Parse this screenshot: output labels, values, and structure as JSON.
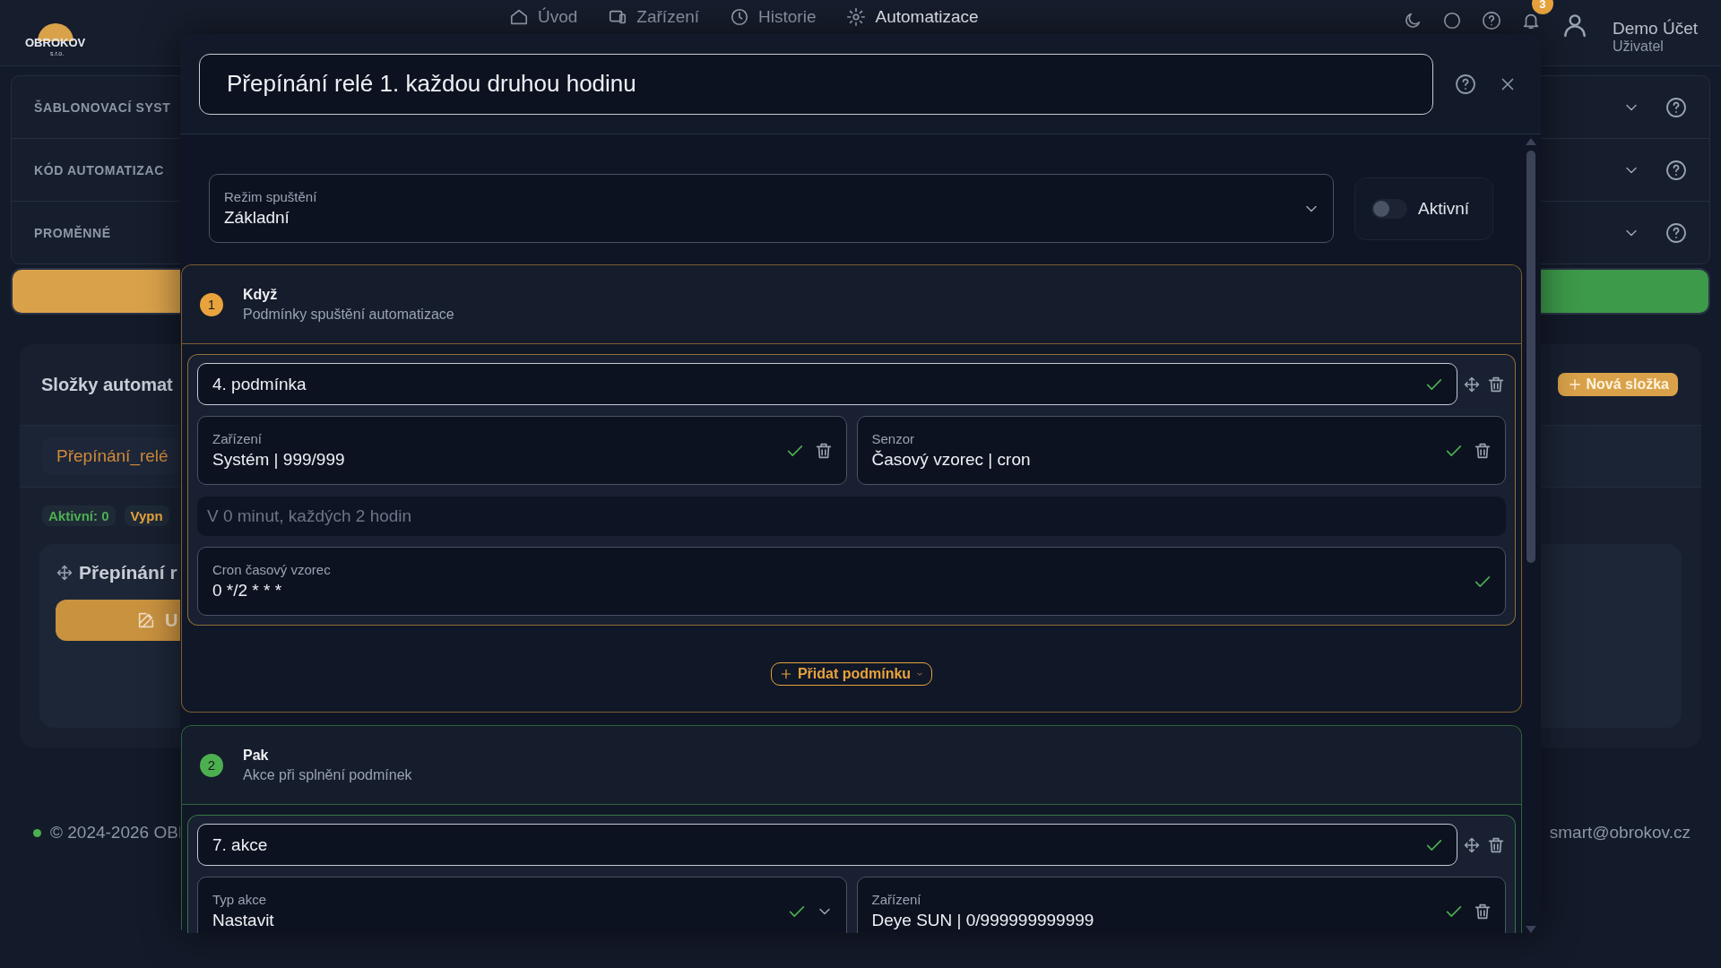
{
  "header": {
    "logo": "OBROKOV",
    "logo_sub": "s.r.o.",
    "nav": [
      {
        "label": "Úvod",
        "selected": false
      },
      {
        "label": "Zařízení",
        "selected": false
      },
      {
        "label": "Historie",
        "selected": false
      },
      {
        "label": "Automatizace",
        "selected": true
      }
    ],
    "notification_count": "3",
    "user": {
      "name": "Demo Účet",
      "role": "Uživatel"
    }
  },
  "accordions": [
    {
      "title": "ŠABLONOVACÍ SYST"
    },
    {
      "title": "KÓD AUTOMATIZAC"
    },
    {
      "title": "PROMĚNNÉ"
    }
  ],
  "folders": {
    "title": "Složky automat",
    "new_button": "Nová složka",
    "tabs": [
      {
        "label": "Přepínání_relé",
        "selected": true
      }
    ],
    "badges": [
      {
        "label": "Aktivní: 0",
        "color": "#4caf50"
      },
      {
        "label": "Vypn",
        "color": "#e8a33d"
      }
    ],
    "card": {
      "title": "Přepínání r",
      "button": "U"
    }
  },
  "footer": {
    "copyright": "© 2024-2026 OBI",
    "email": "smart@obrokov.cz"
  },
  "modal": {
    "title": "Přepínání relé 1. každou druhou hodinu",
    "mode": {
      "label": "Režim spuštění",
      "value": "Základní"
    },
    "active": {
      "label": "Aktivní",
      "on": false
    },
    "sections": [
      {
        "number": "1",
        "title": "Když",
        "subtitle": "Podmínky spuštění automatizace",
        "color": "#e8a33d",
        "items": [
          {
            "title": "4. podmínka",
            "valid": true,
            "fields": [
              {
                "label": "Zařízení",
                "value": "Systém | 999/999",
                "kind": "removable",
                "valid": true
              },
              {
                "label": "Senzor",
                "value": "Časový vzorec | cron",
                "kind": "removable",
                "valid": true
              }
            ],
            "description": "V 0 minut, každých 2 hodin",
            "extra": {
              "label": "Cron časový vzorec",
              "value": "0 */2 * * *",
              "valid": true
            }
          }
        ],
        "add_button": "Přidat podmínku"
      },
      {
        "number": "2",
        "title": "Pak",
        "subtitle": "Akce při splnění podmínek",
        "color": "#4caf50",
        "items": [
          {
            "title": "7. akce",
            "valid": true,
            "fields": [
              {
                "label": "Typ akce",
                "value": "Nastavit",
                "kind": "dropdown",
                "valid": true
              },
              {
                "label": "Zařízení",
                "value": "Deye SUN | 0/999999999999",
                "kind": "removable",
                "valid": true
              }
            ]
          }
        ]
      }
    ]
  }
}
